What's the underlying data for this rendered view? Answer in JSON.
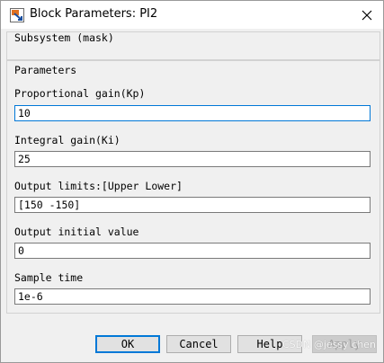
{
  "window": {
    "title": "Block Parameters: PI2",
    "close_glyph": "✕"
  },
  "mask": {
    "label": "Subsystem (mask)"
  },
  "parameters": {
    "label": "Parameters",
    "fields": [
      {
        "label": "Proportional gain(Kp)",
        "value": "10"
      },
      {
        "label": "Integral gain(Ki)",
        "value": "25"
      },
      {
        "label": "Output limits:[Upper Lower]",
        "value": "[150 -150]"
      },
      {
        "label": "Output initial value",
        "value": "0"
      },
      {
        "label": "Sample time",
        "value": "1e-6"
      }
    ]
  },
  "buttons": {
    "ok": "OK",
    "cancel": "Cancel",
    "help": "Help",
    "apply": "Apply"
  },
  "watermark": "CSDN @jessy chen",
  "colors": {
    "focus_border": "#0078d7",
    "background": "#f0f0f0"
  }
}
